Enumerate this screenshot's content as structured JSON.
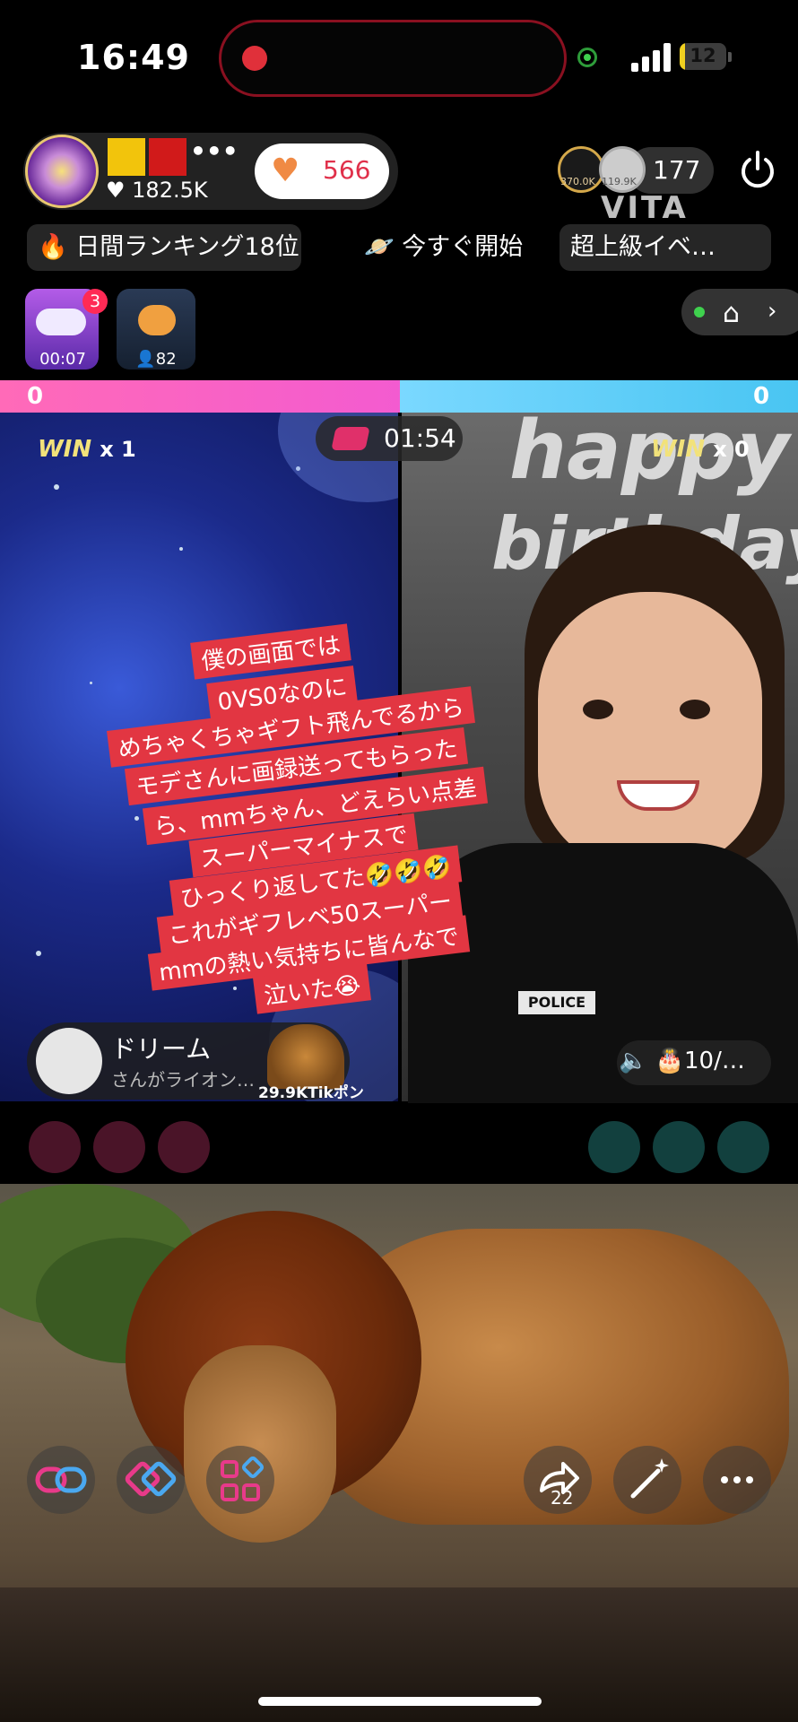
{
  "status_bar": {
    "time": "16:49",
    "battery": "12",
    "battery_level": 0.12
  },
  "host": {
    "likes": "182.5K",
    "flag_colors": [
      "#f2c40c",
      "#d11a1a"
    ],
    "more": "•••"
  },
  "like_button": {
    "count": "566",
    "icon": "heart-icon",
    "color": "#f08a44"
  },
  "top_viewers": [
    {
      "label": "370.0K"
    },
    {
      "label": "119.9K"
    }
  ],
  "viewer_count": "177",
  "watermark": "VITA",
  "tags": {
    "ranking": "日間ランキング18位",
    "start_now": "今すぐ開始",
    "event": "超上級イベ…"
  },
  "widgets": {
    "cloud_badge": "3",
    "cloud_time": "00:07",
    "group_count": "82"
  },
  "battle": {
    "score_left": "0",
    "score_right": "0",
    "timer": "01:54",
    "win_label": "WIN",
    "win_left": "x 1",
    "win_right": "x 0",
    "left_color": "#f35bd0",
    "right_color": "#49c5f2"
  },
  "balloon_text": {
    "line1": "happy",
    "line2": "birthday"
  },
  "shirt_label": "POLICE",
  "gift_info": "10/…",
  "caption_lines": [
    "僕の画面では",
    "0VS0なのに",
    "めちゃくちゃギフト飛んでるから",
    "モデさんに画録送ってもらった",
    "ら、mmちゃん、どえらい点差",
    "スーパーマイナスで",
    "ひっくり返してた🤣🤣🤣",
    "これがギフレベ50スーパー",
    "mmの熱い気持ちに皆んなで",
    "泣いた😭"
  ],
  "gift_notice": {
    "name": "ドリーム",
    "text": "さんがライオン…",
    "price": "29.9KTikポン"
  },
  "seats": {
    "left_color": "#4a1428",
    "right_color": "#12403e"
  },
  "bottom_bar": {
    "share_count": "22"
  }
}
